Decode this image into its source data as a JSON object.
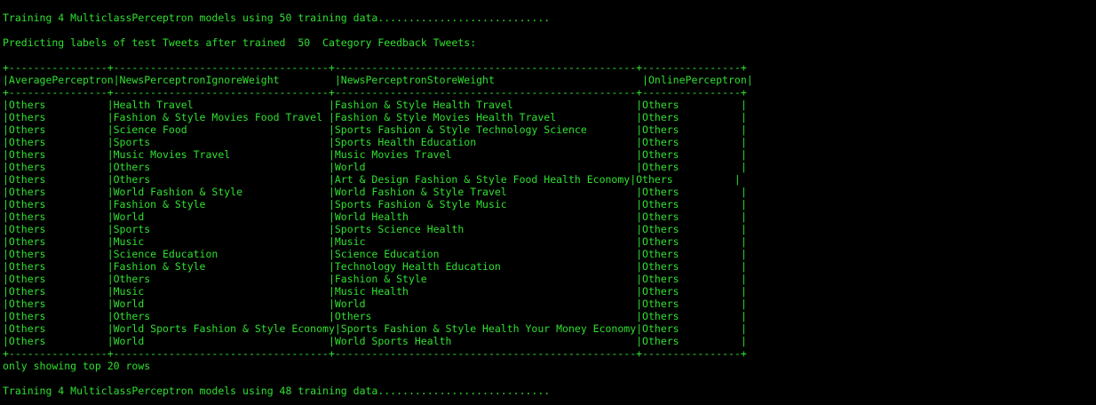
{
  "colors": {
    "background": "#000000",
    "text": "#2fe02f"
  },
  "terminal": {
    "line_1": "Training 4 MulticlassPerceptron models using 50 training data............................",
    "line_2": "",
    "line_3": "Predicting labels of test Tweets after trained  50  Category Feedback Tweets:",
    "line_4": "",
    "line_5": "+----------------+-----------------------------------+-------------------------------------------------+----------------+",
    "line_6": "|AveragePerceptron|NewsPerceptronIgnoreWeight         |NewsPerceptronStoreWeight                        |OnlinePerceptron|",
    "line_7": "+----------------+-----------------------------------+-------------------------------------------------+----------------+",
    "line_8": "|Others          |Health Travel                      |Fashion & Style Health Travel                    |Others          |",
    "line_9": "|Others          |Fashion & Style Movies Food Travel |Fashion & Style Movies Health Travel             |Others          |",
    "line_10": "|Others          |Science Food                       |Sports Fashion & Style Technology Science        |Others          |",
    "line_11": "|Others          |Sports                             |Sports Health Education                          |Others          |",
    "line_12": "|Others          |Music Movies Travel                |Music Movies Travel                              |Others          |",
    "line_13": "|Others          |Others                             |World                                            |Others          |",
    "line_14": "|Others          |Others                             |Art & Design Fashion & Style Food Health Economy|Others          |",
    "line_15": "|Others          |World Fashion & Style              |World Fashion & Style Travel                     |Others          |",
    "line_16": "|Others          |Fashion & Style                    |Sports Fashion & Style Music                     |Others          |",
    "line_17": "|Others          |World                              |World Health                                     |Others          |",
    "line_18": "|Others          |Sports                             |Sports Science Health                            |Others          |",
    "line_19": "|Others          |Music                              |Music                                            |Others          |",
    "line_20": "|Others          |Science Education                  |Science Education                                |Others          |",
    "line_21": "|Others          |Fashion & Style                    |Technology Health Education                      |Others          |",
    "line_22": "|Others          |Others                             |Fashion & Style                                  |Others          |",
    "line_23": "|Others          |Music                              |Music Health                                     |Others          |",
    "line_24": "|Others          |World                              |World                                            |Others          |",
    "line_25": "|Others          |Others                             |Others                                           |Others          |",
    "line_26": "|Others          |World Sports Fashion & Style Economy|Sports Fashion & Style Health Your Money Economy|Others          |",
    "line_27": "|Others          |World                              |World Sports Health                              |Others          |",
    "line_28": "+----------------+-----------------------------------+-------------------------------------------------+----------------+",
    "line_29": "only showing top 20 rows",
    "line_30": "",
    "line_31": "Training 4 MulticlassPerceptron models using 48 training data............................"
  }
}
